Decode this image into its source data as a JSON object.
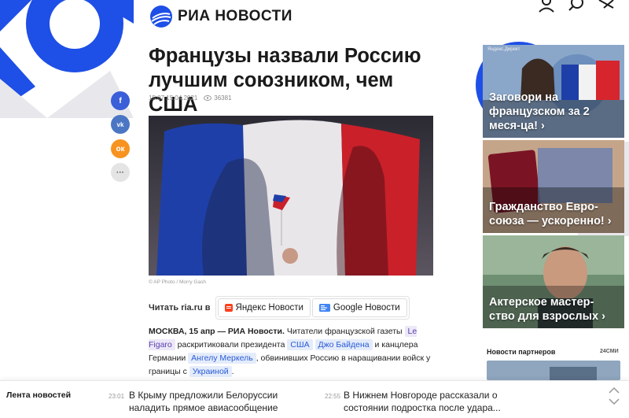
{
  "colors": {
    "brand_blue": "#1e4fe6",
    "accent_light": "#e8e8ec",
    "ok_orange": "#f7931e",
    "fb_blue": "#3b5ed9",
    "vk_blue": "#4a76c4"
  },
  "header": {
    "logo_text": "РИА НОВОСТИ",
    "icons": [
      "user-icon",
      "search-icon",
      "menu-icon"
    ]
  },
  "article": {
    "headline": "Французы назвали Россию лучшим союзником, чем США",
    "time": "15:07 15.04.2021",
    "views": "36381",
    "photo_caption": "© AP Photo / Morry Gash",
    "read_on_label": "Читать ria.ru в",
    "sources": [
      {
        "name": "Яндекс Новости"
      },
      {
        "name": "Google Новости"
      }
    ],
    "body": {
      "lead": "МОСКВА, 15 апр — РИА Новости.",
      "t1": " Читатели французской газеты ",
      "tag1": "Le Figaro",
      "t2": " раскритиковали президента ",
      "tag2": "США",
      "tag3": "Джо Байдена",
      "t3": " и канцлера Германии ",
      "tag4": "Ангелу Меркель",
      "t4": ", обвинивших Россию в наращивании войск у границы с ",
      "tag5": "Украиной",
      "t5": "."
    }
  },
  "share_buttons": [
    "facebook-icon",
    "vk-icon",
    "ok-icon",
    "more-icon"
  ],
  "ads": [
    {
      "small": "Яндекс.Директ",
      "text": "Заговори на французском за 2 меся-ца! ›"
    },
    {
      "text": "Гражданство Евро-союза — ускоренно! ›"
    },
    {
      "text": "Актерское мастер-ство для взрослых ›"
    }
  ],
  "partners": {
    "title": "Новости партнеров",
    "brand": "24СМИ"
  },
  "ticker": {
    "label": "Лента новостей",
    "items": [
      {
        "time": "23:01",
        "text": "В Крыму предложили Белоруссии наладить прямое авиасообщение"
      },
      {
        "time": "22:55",
        "text": "В Нижнем Новгороде рассказали о состоянии подростка после удара..."
      }
    ]
  }
}
